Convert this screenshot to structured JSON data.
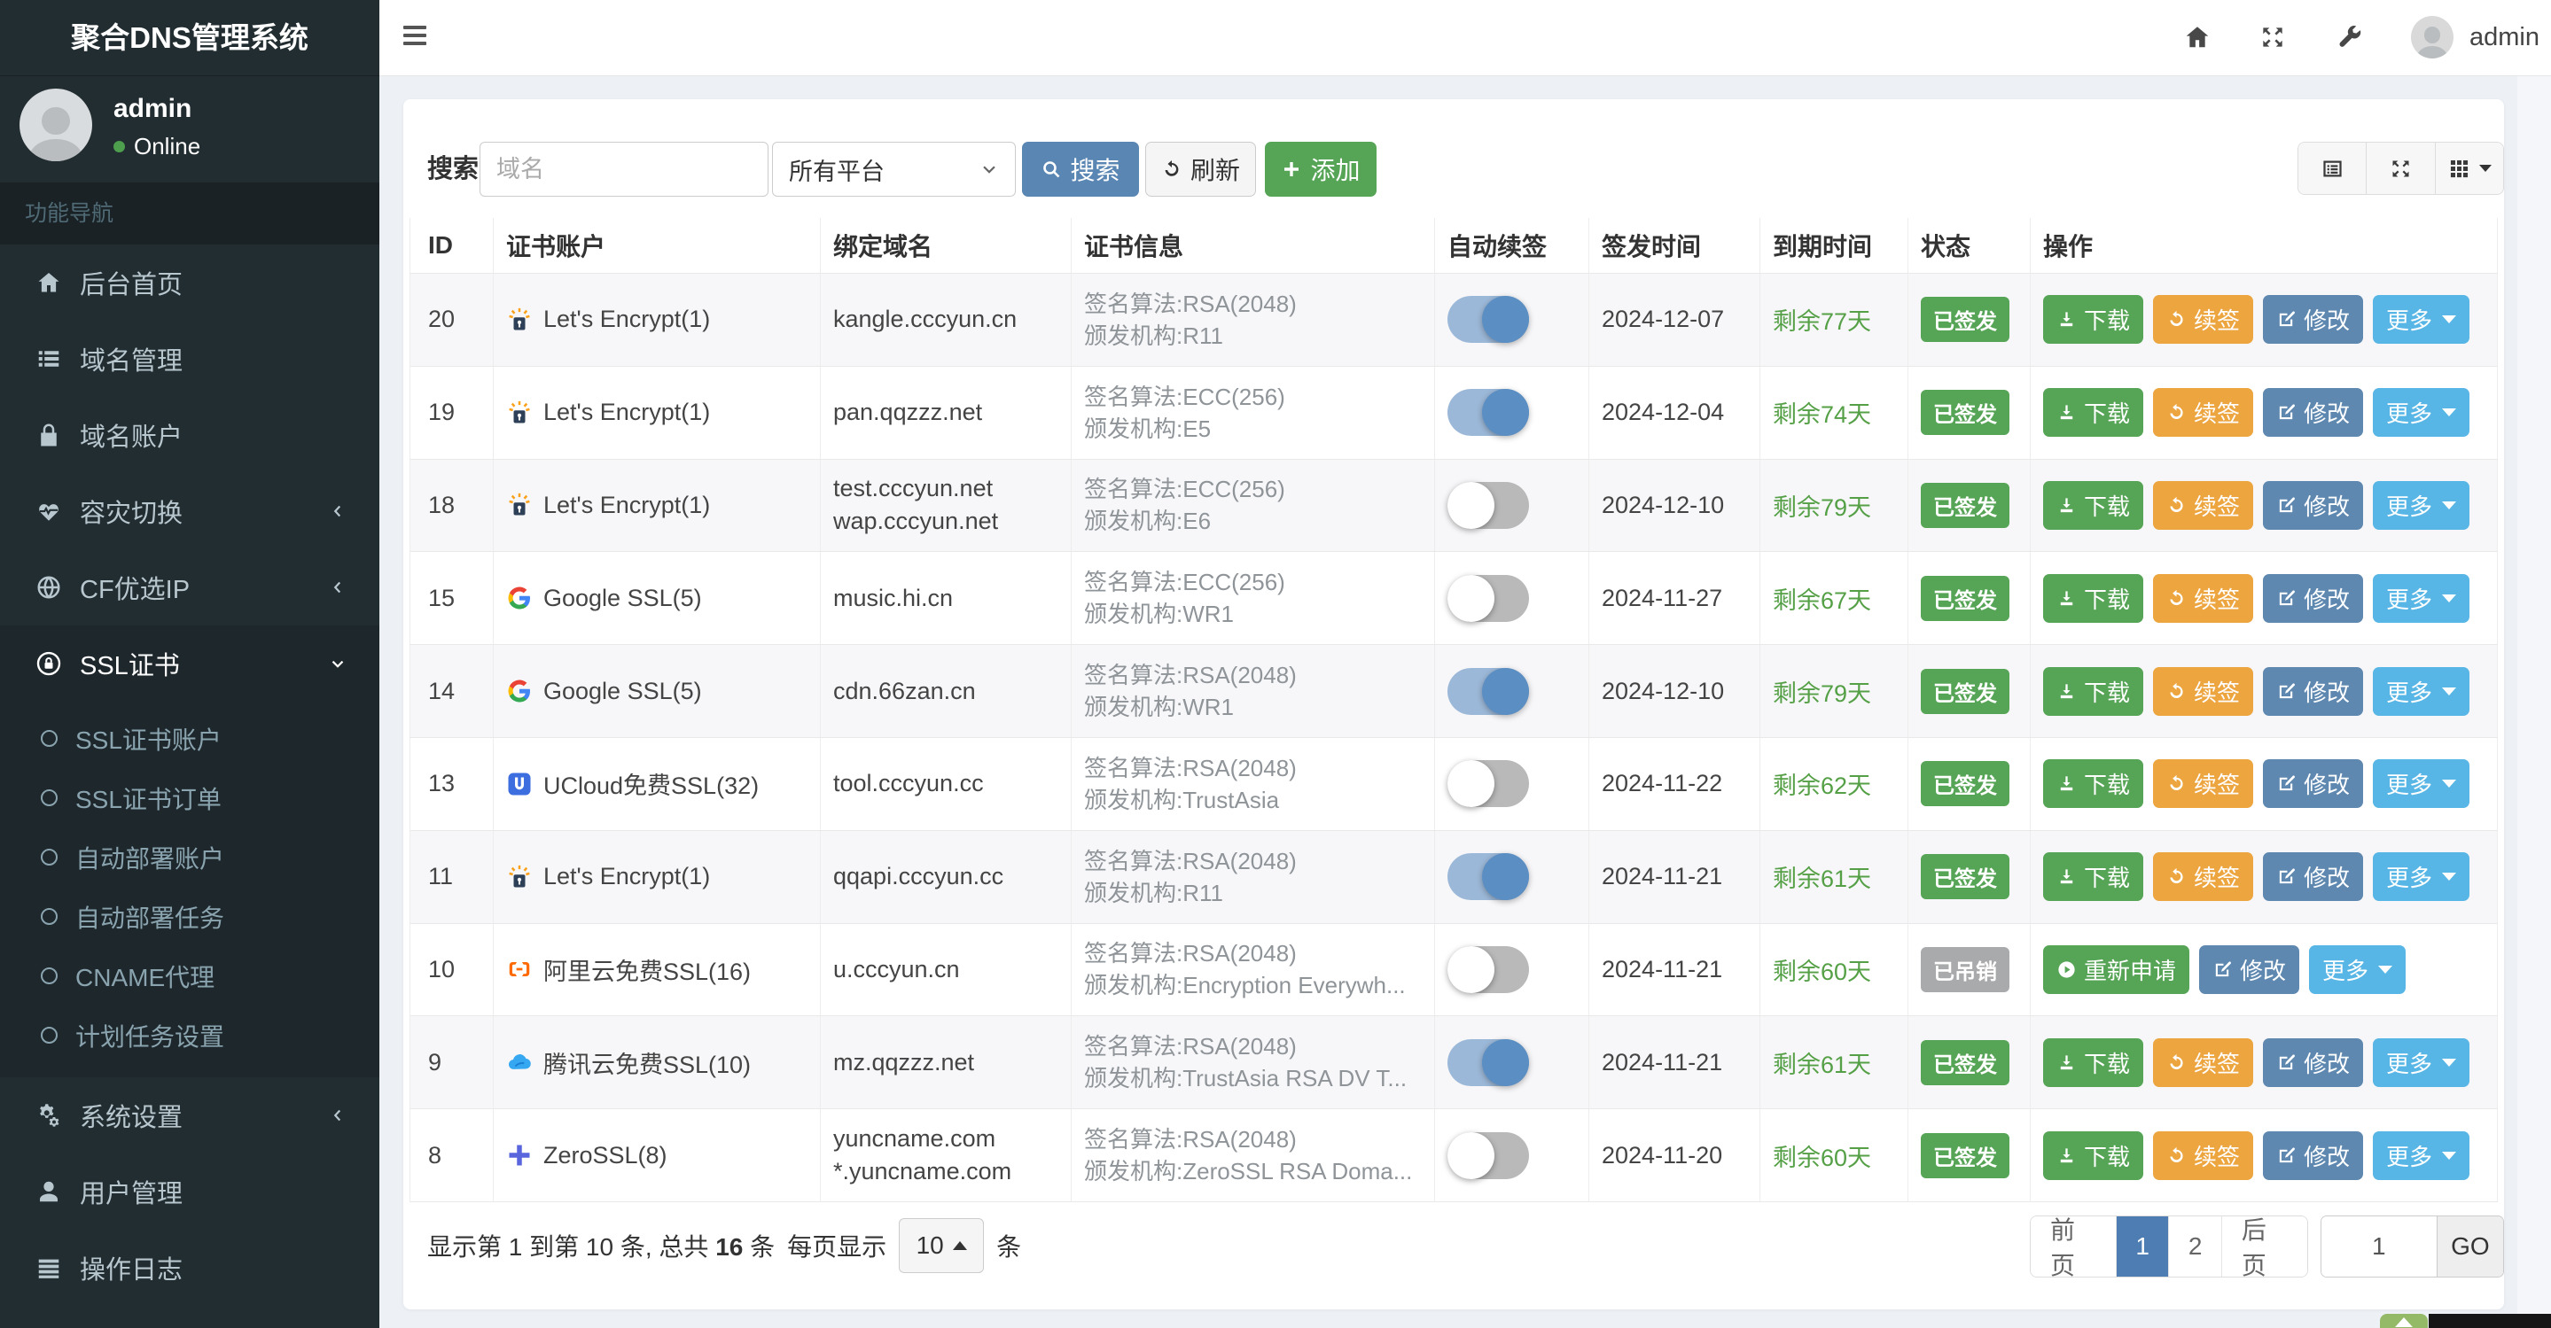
{
  "app": {
    "title": "聚合DNS管理系统"
  },
  "topbar": {
    "username": "admin",
    "icons": [
      "home-icon",
      "fullscreen-icon",
      "wrench-icon"
    ]
  },
  "sidebar": {
    "user": {
      "name": "admin",
      "status": "Online"
    },
    "section_label": "功能导航",
    "items": [
      {
        "icon": "home-icon",
        "label": "后台首页"
      },
      {
        "icon": "list-icon",
        "label": "域名管理"
      },
      {
        "icon": "lock-icon",
        "label": "域名账户"
      },
      {
        "icon": "heartbeat-icon",
        "label": "容灾切换",
        "arrow": "left"
      },
      {
        "icon": "globe-icon",
        "label": "CF优选IP",
        "arrow": "left"
      },
      {
        "icon": "ssl-icon",
        "label": "SSL证书",
        "arrow": "down",
        "active": true,
        "children": [
          {
            "label": "SSL证书账户"
          },
          {
            "label": "SSL证书订单"
          },
          {
            "label": "自动部署账户"
          },
          {
            "label": "自动部署任务"
          },
          {
            "label": "CNAME代理"
          },
          {
            "label": "计划任务设置"
          }
        ]
      },
      {
        "icon": "gears-icon",
        "label": "系统设置",
        "arrow": "left"
      },
      {
        "icon": "user-icon",
        "label": "用户管理"
      },
      {
        "icon": "log-icon",
        "label": "操作日志"
      }
    ]
  },
  "toolbar": {
    "search_label": "搜索",
    "search_placeholder": "域名",
    "platform_select": "所有平台",
    "search_button": "搜索",
    "refresh_button": "刷新",
    "add_button": "添加",
    "view_icons": [
      "columns-icon",
      "fullscreen-icon",
      "grid-icon"
    ]
  },
  "table": {
    "headers": [
      "ID",
      "证书账户",
      "绑定域名",
      "证书信息",
      "自动续签",
      "签发时间",
      "到期时间",
      "状态",
      "操作"
    ],
    "rows": [
      {
        "id": "20",
        "provider_icon": "letsencrypt-icon",
        "account": "Let's Encrypt(1)",
        "domains": [
          "kangle.cccyun.cn"
        ],
        "info": [
          "签名算法:RSA(2048)",
          "颁发机构:R11"
        ],
        "auto_renew": true,
        "issued": "2024-12-07",
        "expires": "剩余77天",
        "status": "已签发",
        "status_type": "signed",
        "actions": [
          {
            "type": "download",
            "label": "下载"
          },
          {
            "type": "renew",
            "label": "续签"
          },
          {
            "type": "edit",
            "label": "修改"
          },
          {
            "type": "more",
            "label": "更多"
          }
        ]
      },
      {
        "id": "19",
        "provider_icon": "letsencrypt-icon",
        "account": "Let's Encrypt(1)",
        "domains": [
          "pan.qqzzz.net"
        ],
        "info": [
          "签名算法:ECC(256)",
          "颁发机构:E5"
        ],
        "auto_renew": true,
        "issued": "2024-12-04",
        "expires": "剩余74天",
        "status": "已签发",
        "status_type": "signed",
        "actions": [
          {
            "type": "download",
            "label": "下载"
          },
          {
            "type": "renew",
            "label": "续签"
          },
          {
            "type": "edit",
            "label": "修改"
          },
          {
            "type": "more",
            "label": "更多"
          }
        ]
      },
      {
        "id": "18",
        "provider_icon": "letsencrypt-icon",
        "account": "Let's Encrypt(1)",
        "domains": [
          "test.cccyun.net",
          "wap.cccyun.net"
        ],
        "info": [
          "签名算法:ECC(256)",
          "颁发机构:E6"
        ],
        "auto_renew": false,
        "issued": "2024-12-10",
        "expires": "剩余79天",
        "status": "已签发",
        "status_type": "signed",
        "actions": [
          {
            "type": "download",
            "label": "下载"
          },
          {
            "type": "renew",
            "label": "续签"
          },
          {
            "type": "edit",
            "label": "修改"
          },
          {
            "type": "more",
            "label": "更多"
          }
        ]
      },
      {
        "id": "15",
        "provider_icon": "google-icon",
        "account": "Google SSL(5)",
        "domains": [
          "music.hi.cn"
        ],
        "info": [
          "签名算法:ECC(256)",
          "颁发机构:WR1"
        ],
        "auto_renew": false,
        "issued": "2024-11-27",
        "expires": "剩余67天",
        "status": "已签发",
        "status_type": "signed",
        "actions": [
          {
            "type": "download",
            "label": "下载"
          },
          {
            "type": "renew",
            "label": "续签"
          },
          {
            "type": "edit",
            "label": "修改"
          },
          {
            "type": "more",
            "label": "更多"
          }
        ]
      },
      {
        "id": "14",
        "provider_icon": "google-icon",
        "account": "Google SSL(5)",
        "domains": [
          "cdn.66zan.cn"
        ],
        "info": [
          "签名算法:RSA(2048)",
          "颁发机构:WR1"
        ],
        "auto_renew": true,
        "issued": "2024-12-10",
        "expires": "剩余79天",
        "status": "已签发",
        "status_type": "signed",
        "actions": [
          {
            "type": "download",
            "label": "下载"
          },
          {
            "type": "renew",
            "label": "续签"
          },
          {
            "type": "edit",
            "label": "修改"
          },
          {
            "type": "more",
            "label": "更多"
          }
        ]
      },
      {
        "id": "13",
        "provider_icon": "ucloud-icon",
        "account": "UCloud免费SSL(32)",
        "domains": [
          "tool.cccyun.cc"
        ],
        "info": [
          "签名算法:RSA(2048)",
          "颁发机构:TrustAsia"
        ],
        "auto_renew": false,
        "issued": "2024-11-22",
        "expires": "剩余62天",
        "status": "已签发",
        "status_type": "signed",
        "actions": [
          {
            "type": "download",
            "label": "下载"
          },
          {
            "type": "renew",
            "label": "续签"
          },
          {
            "type": "edit",
            "label": "修改"
          },
          {
            "type": "more",
            "label": "更多"
          }
        ]
      },
      {
        "id": "11",
        "provider_icon": "letsencrypt-icon",
        "account": "Let's Encrypt(1)",
        "domains": [
          "qqapi.cccyun.cc"
        ],
        "info": [
          "签名算法:RSA(2048)",
          "颁发机构:R11"
        ],
        "auto_renew": true,
        "issued": "2024-11-21",
        "expires": "剩余61天",
        "status": "已签发",
        "status_type": "signed",
        "actions": [
          {
            "type": "download",
            "label": "下载"
          },
          {
            "type": "renew",
            "label": "续签"
          },
          {
            "type": "edit",
            "label": "修改"
          },
          {
            "type": "more",
            "label": "更多"
          }
        ]
      },
      {
        "id": "10",
        "provider_icon": "aliyun-icon",
        "account": "阿里云免费SSL(16)",
        "domains": [
          "u.cccyun.cn"
        ],
        "info": [
          "签名算法:RSA(2048)",
          "颁发机构:Encryption Everywh..."
        ],
        "auto_renew": false,
        "issued": "2024-11-21",
        "expires": "剩余60天",
        "status": "已吊销",
        "status_type": "revoked",
        "actions": [
          {
            "type": "reapply",
            "label": "重新申请"
          },
          {
            "type": "edit",
            "label": "修改"
          },
          {
            "type": "more",
            "label": "更多"
          }
        ]
      },
      {
        "id": "9",
        "provider_icon": "tencent-icon",
        "account": "腾讯云免费SSL(10)",
        "domains": [
          "mz.qqzzz.net"
        ],
        "info": [
          "签名算法:RSA(2048)",
          "颁发机构:TrustAsia RSA DV T..."
        ],
        "auto_renew": true,
        "issued": "2024-11-21",
        "expires": "剩余61天",
        "status": "已签发",
        "status_type": "signed",
        "actions": [
          {
            "type": "download",
            "label": "下载"
          },
          {
            "type": "renew",
            "label": "续签"
          },
          {
            "type": "edit",
            "label": "修改"
          },
          {
            "type": "more",
            "label": "更多"
          }
        ]
      },
      {
        "id": "8",
        "provider_icon": "zerossl-icon",
        "account": "ZeroSSL(8)",
        "domains": [
          "yuncname.com",
          "*.yuncname.com"
        ],
        "info": [
          "签名算法:RSA(2048)",
          "颁发机构:ZeroSSL RSA Doma..."
        ],
        "auto_renew": false,
        "issued": "2024-11-20",
        "expires": "剩余60天",
        "status": "已签发",
        "status_type": "signed",
        "actions": [
          {
            "type": "download",
            "label": "下载"
          },
          {
            "type": "renew",
            "label": "续签"
          },
          {
            "type": "edit",
            "label": "修改"
          },
          {
            "type": "more",
            "label": "更多"
          }
        ]
      }
    ]
  },
  "footer": {
    "summary_prefix": "显示第 1 到第 10 条, 总共 ",
    "summary_total": "16",
    "summary_suffix": " 条",
    "per_page_label": "每页显示",
    "per_page_value": "10",
    "per_page_unit": "条"
  },
  "pagination": {
    "prev": "前页",
    "pages": [
      "1",
      "2"
    ],
    "active_page": "1",
    "next": "后页",
    "jump_value": "1",
    "go_label": "GO"
  },
  "colors": {
    "sidebar_bg": "#222d32",
    "primary_blue": "#5a86b3",
    "success_green": "#56a456",
    "warning_orange": "#eda540",
    "steel_blue": "#5e88b0",
    "info_blue": "#57b6e5",
    "days_green": "#55a046",
    "revoked_gray": "#a9aaac",
    "active_page_blue": "#4d7db3",
    "online_green": "#4d9e4d"
  }
}
